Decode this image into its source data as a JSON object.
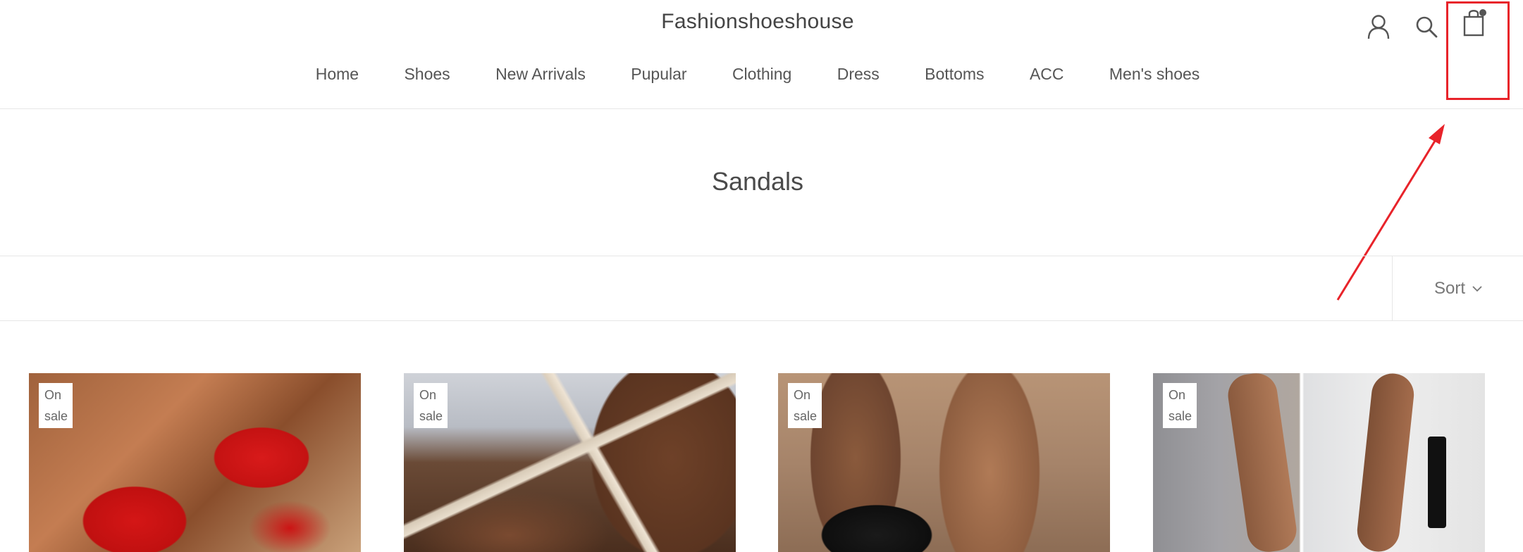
{
  "header": {
    "brand": "Fashionshoeshouse",
    "nav": [
      "Home",
      "Shoes",
      "New Arrivals",
      "Pupular",
      "Clothing",
      "Dress",
      "Bottoms",
      "ACC",
      "Men's shoes"
    ],
    "icons": [
      "account-icon",
      "search-icon",
      "cart-icon"
    ]
  },
  "page": {
    "title": "Sandals"
  },
  "toolbar": {
    "sort_label": "Sort"
  },
  "products": [
    {
      "badge_line1": "On",
      "badge_line2": "sale"
    },
    {
      "badge_line1": "On",
      "badge_line2": "sale"
    },
    {
      "badge_line1": "On",
      "badge_line2": "sale"
    },
    {
      "badge_line1": "On",
      "badge_line2": "sale"
    }
  ],
  "annotation": {
    "color": "#e8232a"
  }
}
